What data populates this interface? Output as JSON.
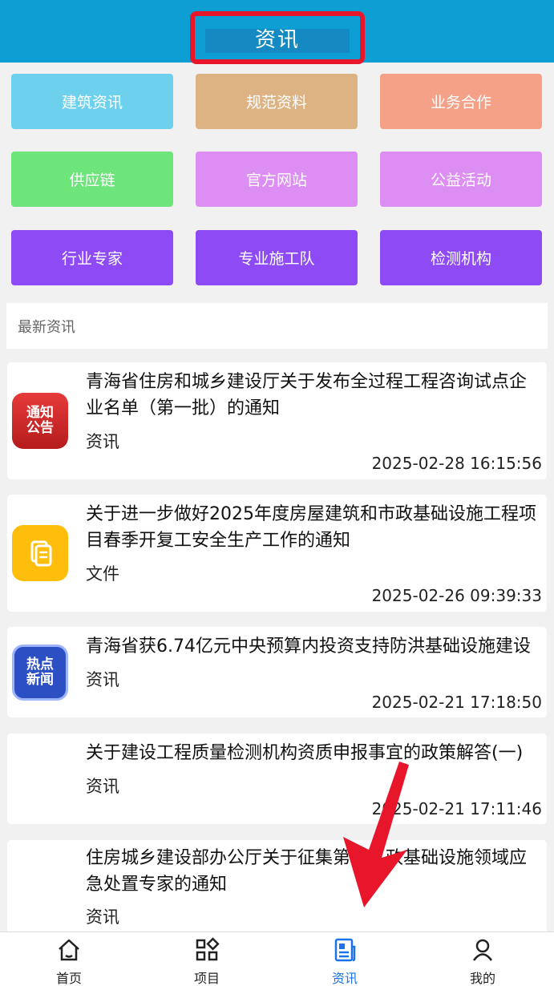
{
  "header": {
    "title": "资讯"
  },
  "menu": [
    {
      "label": "建筑资讯",
      "color": "#6dd1ee"
    },
    {
      "label": "规范资料",
      "color": "#deb383"
    },
    {
      "label": "业务合作",
      "color": "#f5a188"
    },
    {
      "label": "供应链",
      "color": "#6de57b"
    },
    {
      "label": "官方网站",
      "color": "#dc8ef2"
    },
    {
      "label": "公益活动",
      "color": "#dc8ef2"
    },
    {
      "label": "行业专家",
      "color": "#8e4af5"
    },
    {
      "label": "专业施工队",
      "color": "#8e4af5"
    },
    {
      "label": "检测机构",
      "color": "#8e4af5"
    }
  ],
  "section": {
    "title": "最新资讯"
  },
  "news": [
    {
      "title": "青海省住房和城乡建设厅关于发布全过程工程咨询试点企业名单（第一批）的通知",
      "category": "资讯",
      "time": "2025-02-28 16:15:56",
      "badge": "通知公告",
      "icon": "notice-icon"
    },
    {
      "title": "关于进一步做好2025年度房屋建筑和市政基础设施工程项目春季开复工安全生产工作的通知",
      "category": "文件",
      "time": "2025-02-26 09:39:33",
      "icon": "document-icon"
    },
    {
      "title": "青海省获6.74亿元中央预算内投资支持防洪基础设施建设",
      "category": "资讯",
      "time": "2025-02-21 17:18:50",
      "badge": "热点新闻",
      "icon": "hot-news-icon"
    },
    {
      "title": "关于建设工程质量检测机构资质申报事宜的政策解答(一)",
      "category": "资讯",
      "time": "2025-02-21 17:11:46"
    },
    {
      "title": "住房城乡建设部办公厅关于征集第……政基础设施领域应急处置专家的通知",
      "category": "资讯"
    }
  ],
  "tabs": [
    {
      "label": "首页",
      "icon": "home-icon"
    },
    {
      "label": "项目",
      "icon": "grid-icon"
    },
    {
      "label": "资讯",
      "icon": "news-icon",
      "active": true
    },
    {
      "label": "我的",
      "icon": "person-icon"
    }
  ],
  "accent": "#0d9fd3"
}
